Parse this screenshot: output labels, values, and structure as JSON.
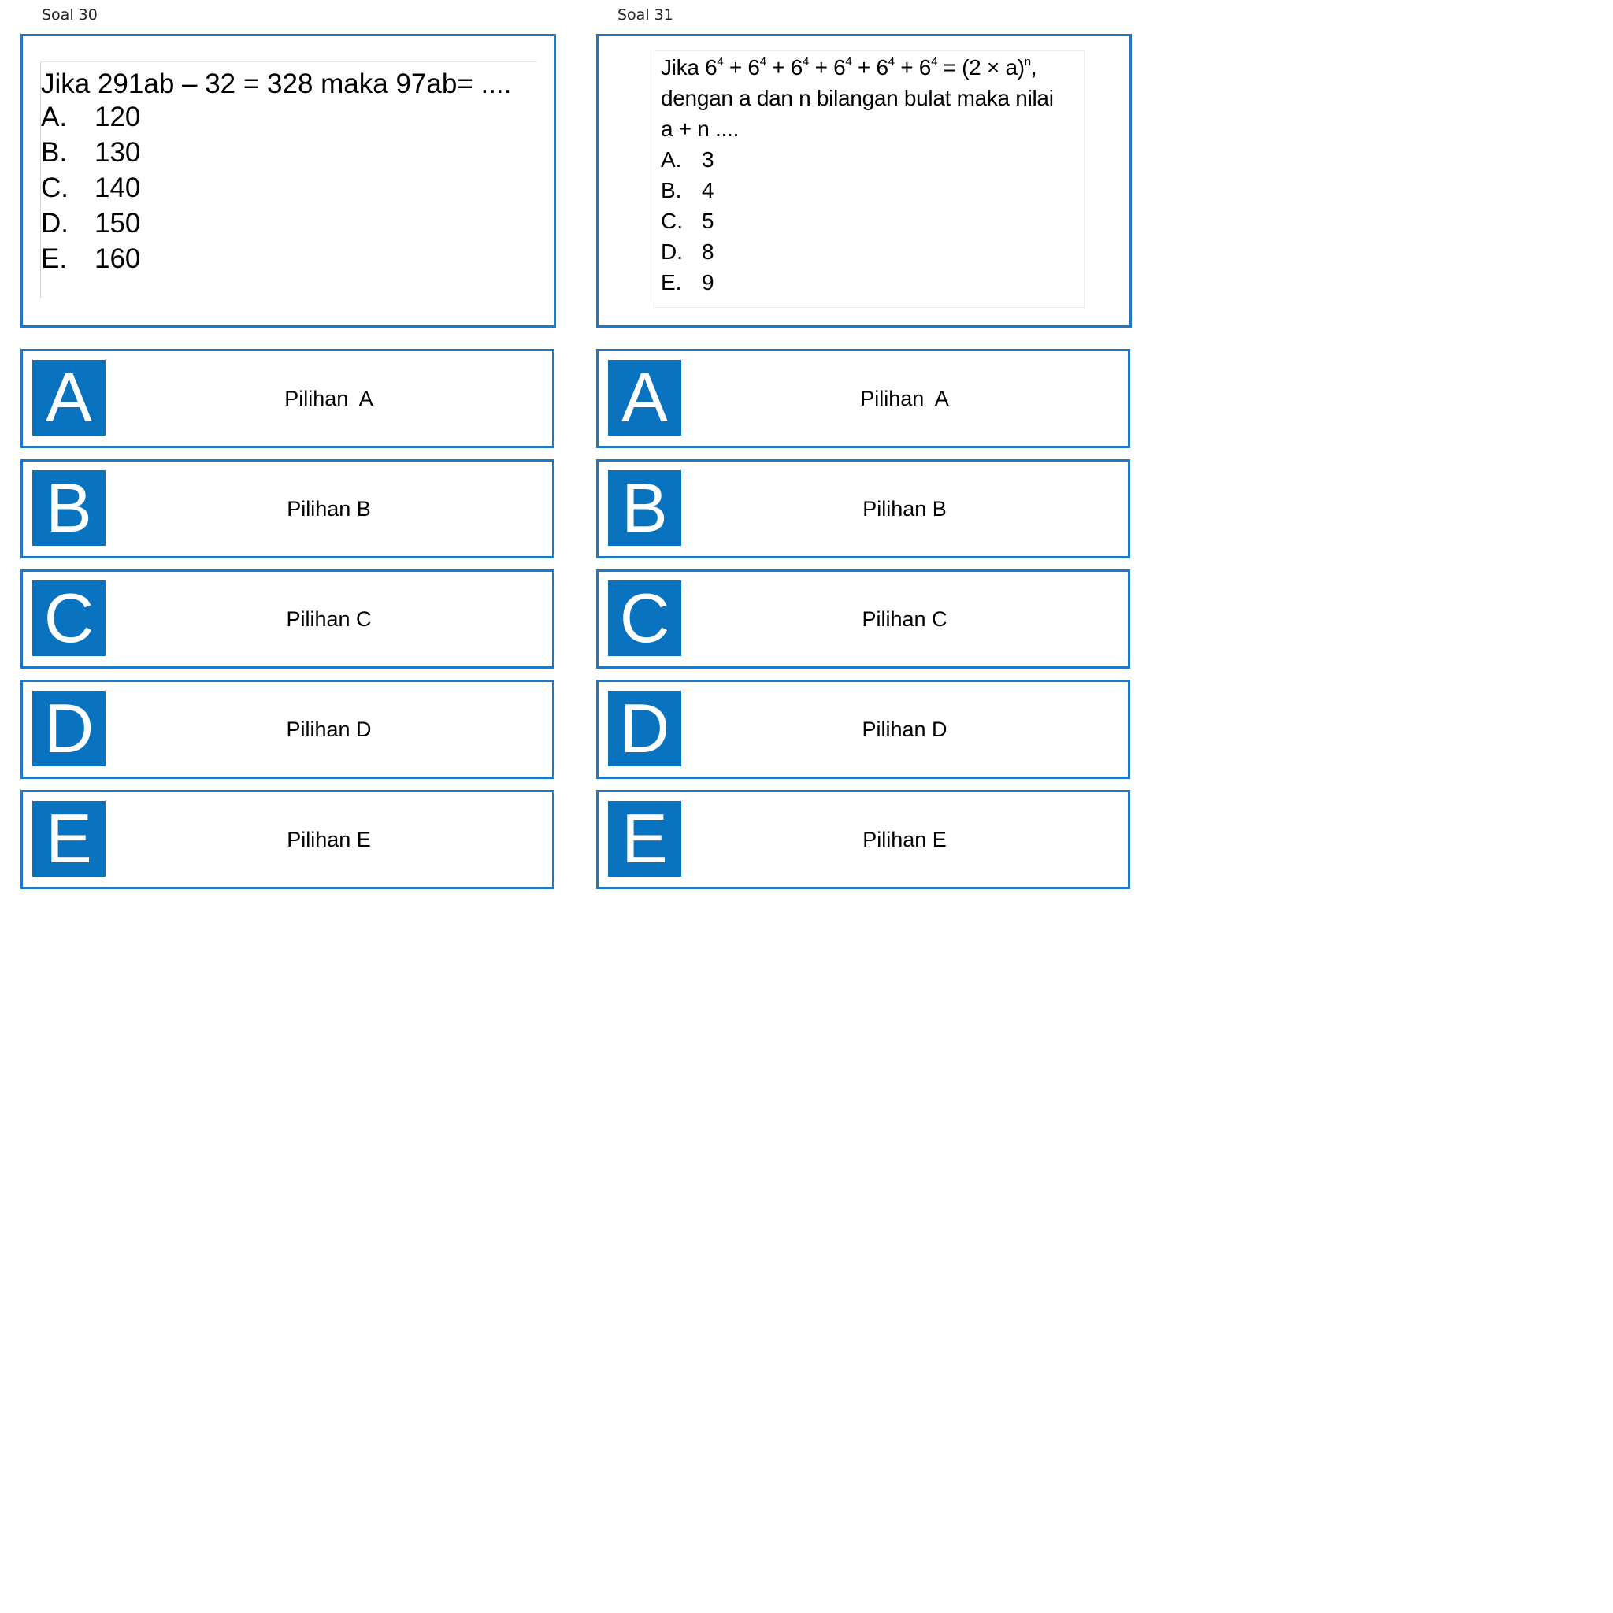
{
  "soal30": {
    "label": "Soal 30",
    "question": "Jika 291ab – 32 = 328 maka 97ab= ....",
    "options": [
      {
        "letter": "A.",
        "value": "120"
      },
      {
        "letter": "B.",
        "value": "130"
      },
      {
        "letter": "C.",
        "value": "140"
      },
      {
        "letter": "D.",
        "value": "150"
      },
      {
        "letter": "E.",
        "value": "160"
      }
    ],
    "choices": [
      {
        "badge": "A",
        "label": "Pilihan  A"
      },
      {
        "badge": "B",
        "label": "Pilihan B"
      },
      {
        "badge": "C",
        "label": "Pilihan C"
      },
      {
        "badge": "D",
        "label": "Pilihan D"
      },
      {
        "badge": "E",
        "label": "Pilihan E"
      }
    ]
  },
  "soal31": {
    "label": "Soal 31",
    "question": {
      "jika": "Jika",
      "base": "6",
      "exp": "4",
      "plus": " + ",
      "equals_open": " = (2 × a)",
      "exp_n": "n",
      "comma": ",",
      "line2": "dengan a dan n bilangan bulat maka nilai",
      "line3": "a + n ...."
    },
    "options": [
      {
        "letter": "A.",
        "value": "3"
      },
      {
        "letter": "B.",
        "value": "4"
      },
      {
        "letter": "C.",
        "value": "5"
      },
      {
        "letter": "D.",
        "value": "8"
      },
      {
        "letter": "E.",
        "value": "9"
      }
    ],
    "choices": [
      {
        "badge": "A",
        "label": "Pilihan  A"
      },
      {
        "badge": "B",
        "label": "Pilihan B"
      },
      {
        "badge": "C",
        "label": "Pilihan C"
      },
      {
        "badge": "D",
        "label": "Pilihan D"
      },
      {
        "badge": "E",
        "label": "Pilihan E"
      }
    ]
  },
  "colors": {
    "border": "#1f78c8",
    "badge": "#0a73bf",
    "badge_text": "#ffffff"
  }
}
